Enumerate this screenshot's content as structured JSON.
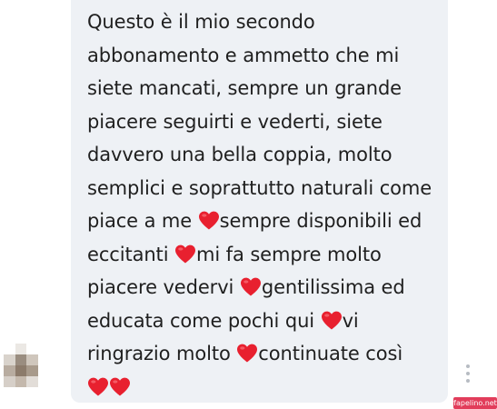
{
  "message": {
    "lines": [
      "Questo è il mio secondo",
      "abbonamento e ammetto che mi",
      "siete mancati, sempre un grande",
      "piacere seguirti e vederti, siete",
      "davvero una bella coppia, molto",
      "semplici e soprattutto naturali come",
      "piace a me ",
      "sempre disponibili ed",
      "eccitanti ",
      "mi fa sempre molto",
      "piacere vedervi ",
      "gentilissima ed",
      "educata come pochi qui ",
      "vi",
      "ringrazio molto ",
      "continuate così"
    ]
  },
  "icons": {
    "heart": "red-heart-emoji",
    "more": "vertical-ellipsis-icon"
  },
  "colors": {
    "bubble_background": "#eef1f5",
    "text": "#1f1f1f",
    "heart": "#e8202f",
    "watermark_background": "#e23d5b"
  },
  "watermark": {
    "text": "fapelino.net"
  }
}
